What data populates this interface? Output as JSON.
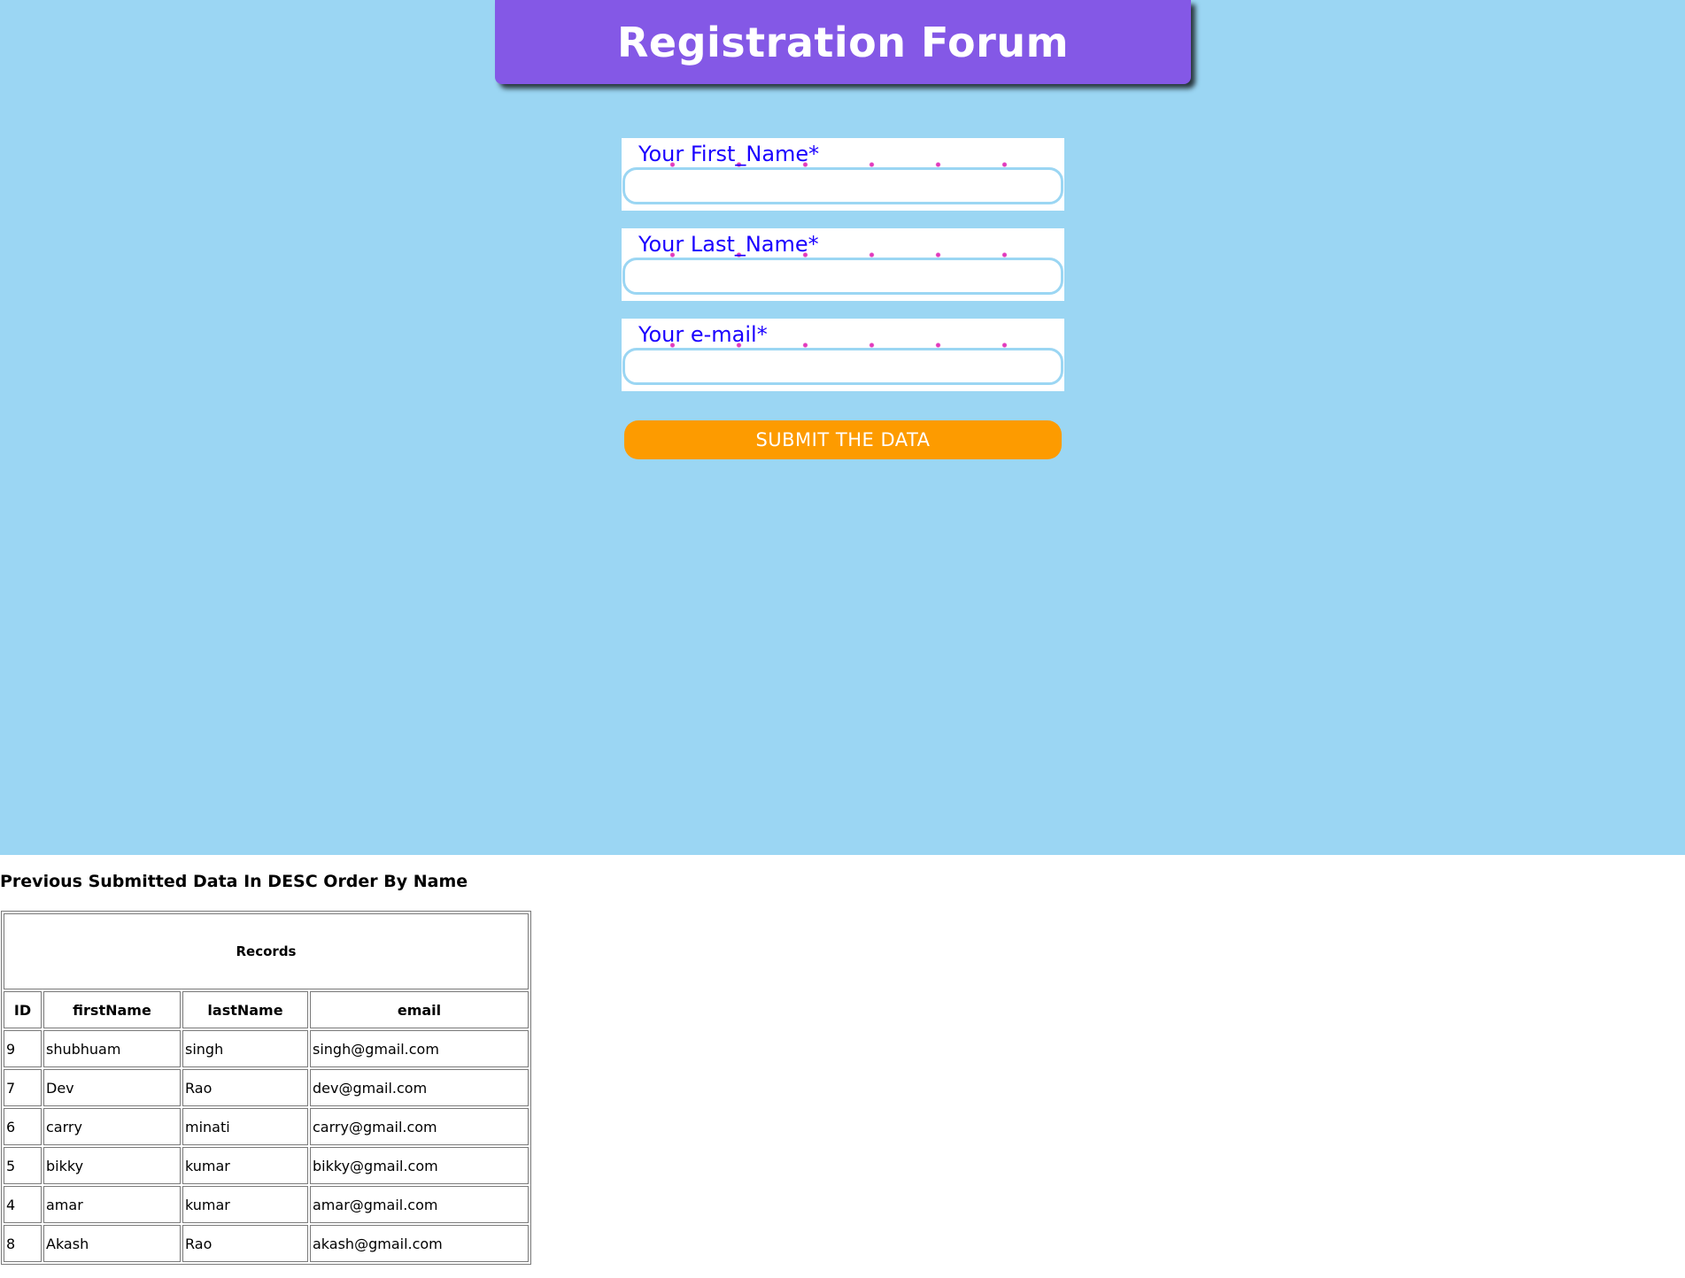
{
  "header": {
    "title": "Registration Forum"
  },
  "form": {
    "fields": [
      {
        "label": "Your First_Name*",
        "value": ""
      },
      {
        "label": "Your Last_Name*",
        "value": ""
      },
      {
        "label": "Your e-mail*",
        "value": ""
      }
    ],
    "submit_label": "SUBMIT THE DATA"
  },
  "records": {
    "heading": "Previous Submitted Data In DESC Order By Name",
    "caption": "Records",
    "columns": [
      "ID",
      "firstName",
      "lastName",
      "email"
    ],
    "rows": [
      [
        "9",
        "shubhuam",
        "singh",
        "singh@gmail.com"
      ],
      [
        "7",
        "Dev",
        "Rao",
        "dev@gmail.com"
      ],
      [
        "6",
        "carry",
        "minati",
        "carry@gmail.com"
      ],
      [
        "5",
        "bikky",
        "kumar",
        "bikky@gmail.com"
      ],
      [
        "4",
        "amar",
        "kumar",
        "amar@gmail.com"
      ],
      [
        "8",
        "Akash",
        "Rao",
        "akash@gmail.com"
      ]
    ]
  },
  "colors": {
    "page_background": "#9bd6f3",
    "header_background": "#8458e6",
    "label_text": "#1a00ff",
    "submit_background": "#fd9b00",
    "sparkle": "#e23bbd"
  }
}
